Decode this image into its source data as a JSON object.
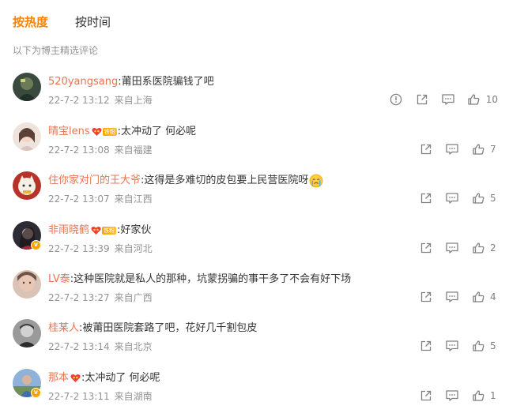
{
  "tabs": [
    {
      "label": "按热度",
      "active": true
    },
    {
      "label": "按时间",
      "active": false
    }
  ],
  "section_note": "以下为博主精选评论",
  "colors": {
    "accent": "#ff8200",
    "username": "#eb7350",
    "meta": "#939393",
    "icon": "#808080"
  },
  "comments": [
    {
      "user": "520yangsang",
      "text": ":莆田系医院骗钱了吧",
      "date": "22-7-2 13:12",
      "location": "来自上海",
      "likes": "10",
      "has_report": true,
      "fan_badge": false,
      "emoji": false,
      "verified": false,
      "avatar_icon": "dark-game-avatar"
    },
    {
      "user": "晴宝lens",
      "text": ":太冲动了 何必呢",
      "date": "22-7-2 13:08",
      "location": "来自福建",
      "likes": "7",
      "has_report": false,
      "fan_badge": true,
      "fan_label": "铁粉",
      "emoji": false,
      "verified": false,
      "avatar_icon": "girl-portrait-avatar"
    },
    {
      "user": "住你家对门的王大爷",
      "text": ":这得是多难切的皮包要上民营医院呀",
      "date": "22-7-2 13:07",
      "location": "来自江西",
      "likes": "5",
      "has_report": false,
      "fan_badge": false,
      "emoji": true,
      "emoji_icon": "crying-face-emoji",
      "verified": false,
      "avatar_icon": "lucky-cat-avatar"
    },
    {
      "user": "非雨晓鹤",
      "text": ":好家伙",
      "date": "22-7-2 13:39",
      "location": "来自河北",
      "likes": "2",
      "has_report": false,
      "fan_badge": true,
      "fan_label": "铁粉",
      "emoji": false,
      "verified": true,
      "avatar_icon": "woman-dark-hair-avatar"
    },
    {
      "user": "LV泰",
      "text": ":这种医院就是私人的那种，坑蒙拐骗的事干多了不会有好下场",
      "date": "22-7-2 13:27",
      "location": "来自广西",
      "likes": "4",
      "has_report": false,
      "fan_badge": false,
      "emoji": false,
      "verified": false,
      "avatar_icon": "woman-face-avatar"
    },
    {
      "user": "桂某人",
      "text": ":被莆田医院套路了吧，花好几千割包皮",
      "date": "22-7-2 13:14",
      "location": "来自北京",
      "likes": "5",
      "has_report": false,
      "fan_badge": false,
      "emoji": false,
      "verified": false,
      "avatar_icon": "man-grayscale-avatar"
    },
    {
      "user": "那本",
      "text": ":太冲动了 何必呢",
      "date": "22-7-2 13:11",
      "location": "来自湖南",
      "likes": "1",
      "has_report": false,
      "fan_badge": true,
      "fan_label": "",
      "emoji": false,
      "verified": true,
      "avatar_icon": "man-outdoor-avatar"
    }
  ]
}
